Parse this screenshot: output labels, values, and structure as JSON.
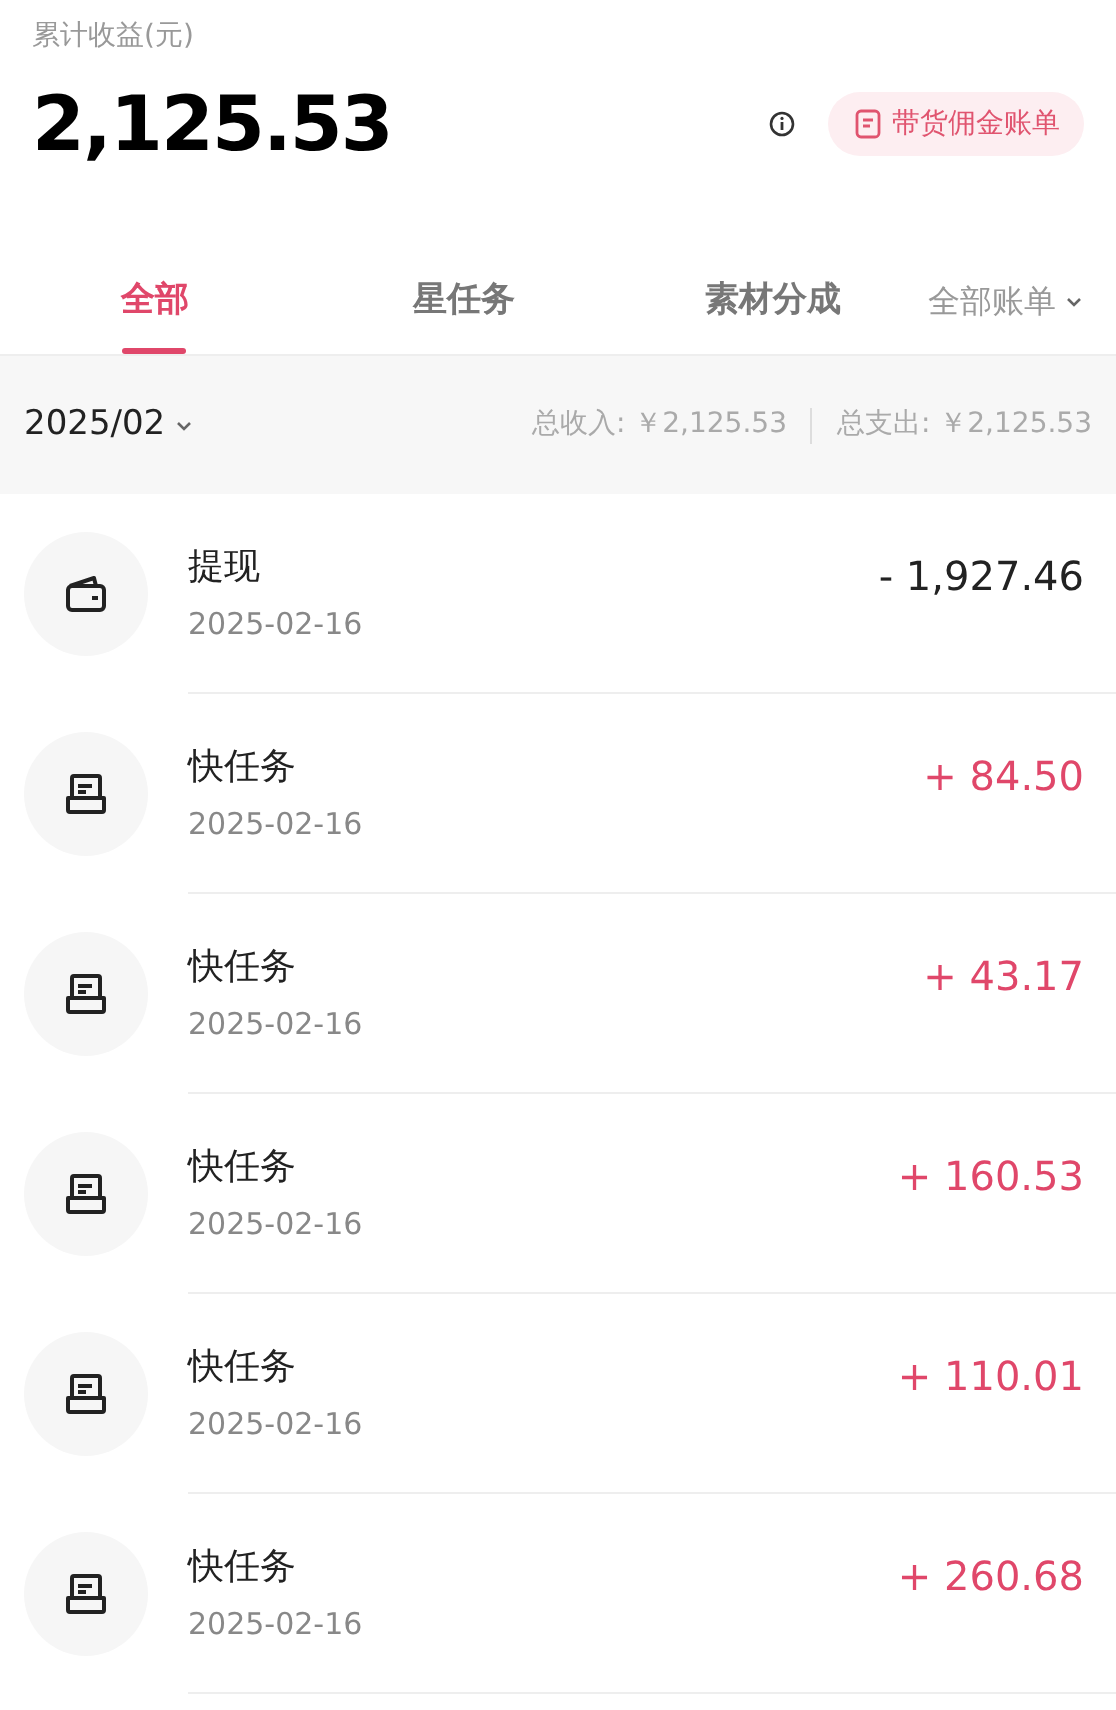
{
  "summary": {
    "label": "累计收益(元)",
    "total": "2,125.53",
    "bill_button": "带货佣金账单"
  },
  "tabs": [
    {
      "label": "全部",
      "selected": true
    },
    {
      "label": "星任务",
      "selected": false
    },
    {
      "label": "素材分成",
      "selected": false
    }
  ],
  "filter_dropdown": "全部账单",
  "filter_bar": {
    "month": "2025/02",
    "income": "总收入: ￥2,125.53",
    "expense": "总支出: ￥2,125.53"
  },
  "transactions": [
    {
      "kind": "withdrawal",
      "title": "提现",
      "date": "2025-02-16",
      "amount": "- 1,927.46"
    },
    {
      "kind": "income",
      "title": "快任务",
      "date": "2025-02-16",
      "amount": "+ 84.50"
    },
    {
      "kind": "income",
      "title": "快任务",
      "date": "2025-02-16",
      "amount": "+ 43.17"
    },
    {
      "kind": "income",
      "title": "快任务",
      "date": "2025-02-16",
      "amount": "+ 160.53"
    },
    {
      "kind": "income",
      "title": "快任务",
      "date": "2025-02-16",
      "amount": "+ 110.01"
    },
    {
      "kind": "income",
      "title": "快任务",
      "date": "2025-02-16",
      "amount": "+ 260.68"
    }
  ]
}
